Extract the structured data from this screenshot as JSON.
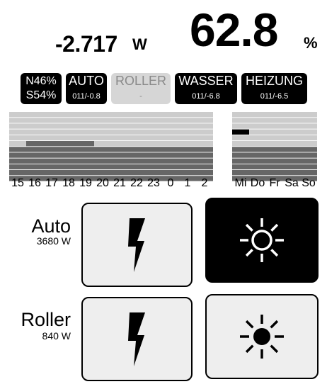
{
  "header": {
    "power_value": "-2.717",
    "power_unit": "W",
    "soc_value": "62.8",
    "soc_unit": "%"
  },
  "badges": {
    "battery": {
      "line1": "N46%",
      "line2": "S54%"
    },
    "auto": {
      "label": "AUTO",
      "sub": "011/-0.8"
    },
    "roller": {
      "label": "ROLLER",
      "sub": "-"
    },
    "wasser": {
      "label": "WASSER",
      "sub": "011/-6.8"
    },
    "heizung": {
      "label": "HEIZUNG",
      "sub": "011/-6.5"
    }
  },
  "hourly_chart": {
    "ticks": [
      "15",
      "16",
      "17",
      "18",
      "19",
      "20",
      "21",
      "22",
      "23",
      "0",
      "1",
      "2"
    ],
    "levels": [
      3,
      4,
      4,
      4,
      4,
      3,
      3,
      3,
      3,
      3,
      3,
      3
    ],
    "peak": [
      false,
      false,
      false,
      false,
      false,
      false,
      false,
      false,
      false,
      false,
      false,
      false
    ]
  },
  "daily_chart": {
    "ticks": [
      "Mi",
      "Do",
      "Fr",
      "Sa",
      "So"
    ],
    "levels": [
      3,
      3,
      3,
      3,
      3
    ],
    "peak": [
      true,
      false,
      false,
      false,
      false
    ]
  },
  "consumers": [
    {
      "name": "Auto",
      "watt": "3680 W",
      "power_icon": "lightning-icon",
      "sun_icon": "sun-icon",
      "sun_active": true
    },
    {
      "name": "Roller",
      "watt": "840 W",
      "power_icon": "lightning-icon",
      "sun_icon": "sun-icon",
      "sun_active": false
    }
  ],
  "colors": {
    "bar_dark": "#666666",
    "bar_light": "#cccccc",
    "bar_separator": "#ffffff",
    "peak": "#000000",
    "button_bg": "#eeeeee",
    "button_active_bg": "#000000",
    "badge_bg": "#000000",
    "badge_inactive_bg": "#d6d6d6"
  }
}
